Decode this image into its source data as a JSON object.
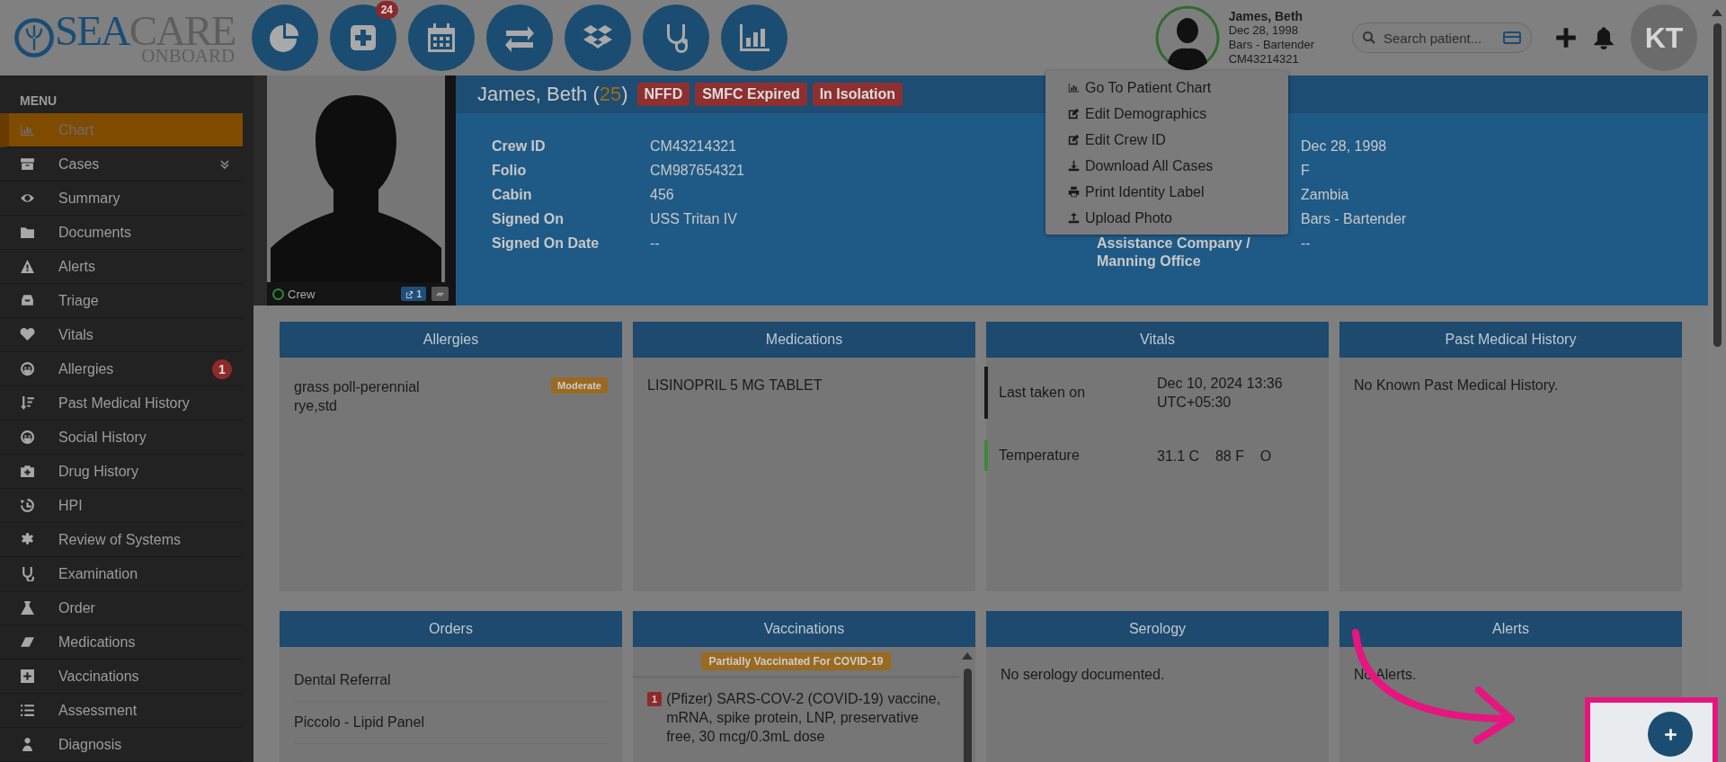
{
  "brand": {
    "name_a": "SEA",
    "name_b": "CARE",
    "sub": "ONBOARD"
  },
  "nav_badge": "24",
  "patient_summary": {
    "name": "James, Beth",
    "dob": "Dec 28, 1998",
    "role": "Bars - Bartender",
    "crew_id": "CM43214321"
  },
  "search": {
    "placeholder": "Search patient..."
  },
  "user": {
    "initials": "KT"
  },
  "sidebar": {
    "title": "MENU",
    "items": [
      {
        "label": "Chart",
        "selected": true,
        "expandable": false
      },
      {
        "label": "Cases",
        "selected": false,
        "expandable": true
      },
      {
        "label": "Summary",
        "selected": false,
        "expandable": false
      },
      {
        "label": "Documents",
        "selected": false,
        "expandable": false
      },
      {
        "label": "Alerts",
        "selected": false,
        "expandable": false
      },
      {
        "label": "Triage",
        "selected": false,
        "expandable": false
      },
      {
        "label": "Vitals",
        "selected": false,
        "expandable": false
      },
      {
        "label": "Allergies",
        "selected": false,
        "expandable": false,
        "badge": "1"
      },
      {
        "label": "Past Medical History",
        "selected": false,
        "expandable": false
      },
      {
        "label": "Social History",
        "selected": false,
        "expandable": false
      },
      {
        "label": "Drug History",
        "selected": false,
        "expandable": false
      },
      {
        "label": "HPI",
        "selected": false,
        "expandable": false
      },
      {
        "label": "Review of Systems",
        "selected": false,
        "expandable": false
      },
      {
        "label": "Examination",
        "selected": false,
        "expandable": false
      },
      {
        "label": "Order",
        "selected": false,
        "expandable": false
      },
      {
        "label": "Medications",
        "selected": false,
        "expandable": false
      },
      {
        "label": "Vaccinations",
        "selected": false,
        "expandable": false
      },
      {
        "label": "Assessment",
        "selected": false,
        "expandable": false
      },
      {
        "label": "Diagnosis",
        "selected": false,
        "expandable": false
      }
    ]
  },
  "photo_panel": {
    "status": "Crew",
    "share_count": "1"
  },
  "patient_header": {
    "name_prefix": "James, Beth (",
    "age": "25",
    "name_suffix": ")",
    "tags": [
      "NFFD",
      "SMFC Expired",
      "In Isolation"
    ]
  },
  "details_left": [
    {
      "label": "Crew ID",
      "value": "CM43214321"
    },
    {
      "label": "Folio",
      "value": "CM987654321"
    },
    {
      "label": "Cabin",
      "value": "456"
    },
    {
      "label": "Signed On",
      "value": "USS Tritan IV"
    },
    {
      "label": "Signed On Date",
      "value": "--"
    }
  ],
  "details_right": [
    {
      "value": "Dec 28, 1998"
    },
    {
      "value": "F"
    },
    {
      "value": "Zambia"
    },
    {
      "value": "Bars - Bartender"
    },
    {
      "label": "Assistance Company / Manning Office",
      "value": "--"
    }
  ],
  "actions_menu": [
    "Go To Patient Chart",
    "Edit Demographics",
    "Edit Crew ID",
    "Download All Cases",
    "Print Identity Label",
    "Upload Photo"
  ],
  "cards": [
    {
      "kind": "allergies",
      "title": "Allergies",
      "items": [
        {
          "text": "grass poll-perennial rye,std",
          "severity": "Moderate"
        }
      ]
    },
    {
      "kind": "list",
      "title": "Medications",
      "items": [
        {
          "text": "LISINOPRIL 5 MG TABLET"
        }
      ]
    },
    {
      "kind": "vitals",
      "title": "Vitals",
      "items": [
        {
          "label": "Last taken on",
          "value": "Dec 10, 2024 13:36 UTC+05:30",
          "color": "#1a1a1a"
        },
        {
          "label": "Temperature",
          "value": "31.1 C    88 F    O",
          "color": "#3a8a3a"
        }
      ]
    },
    {
      "kind": "text",
      "title": "Past Medical History",
      "text": "No Known Past Medical History."
    },
    {
      "kind": "rows",
      "title": "Orders",
      "items": [
        {
          "text": "Dental Referral"
        },
        {
          "text": "Piccolo - Lipid Panel"
        }
      ]
    },
    {
      "kind": "vaccinations",
      "title": "Vaccinations",
      "status": "Partially Vaccinated For COVID-19",
      "items": [
        {
          "count": "1",
          "text": "(Pfizer) SARS-COV-2 (COVID-19) vaccine, mRNA, spike protein, LNP, preservative free, 30 mcg/0.3mL dose"
        }
      ]
    },
    {
      "kind": "text",
      "title": "Serology",
      "text": "No serology documented."
    },
    {
      "kind": "text",
      "title": "Alerts",
      "text": "No Alerts."
    }
  ]
}
